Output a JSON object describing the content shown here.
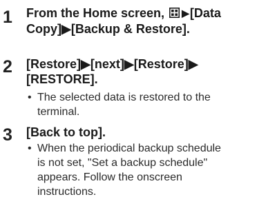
{
  "steps": [
    {
      "number": "1",
      "lines": [
        {
          "a": "From the Home screen, ",
          "icon": "apps-grid-icon",
          "b": "▶",
          "c": "[Data"
        },
        {
          "text": "Copy]▶[Backup & Restore]."
        }
      ]
    },
    {
      "number": "2",
      "line1": "[Restore]▶[next]▶[Restore]▶",
      "line2": "[RESTORE].",
      "note_bullet": "•",
      "note_line1": "The selected data is restored to the",
      "note_line2": "terminal."
    },
    {
      "number": "3",
      "line1": "[Back to top].",
      "note_bullet": "•",
      "note_line1": "When the periodical backup schedule",
      "note_line2": "is not set, \"Set a backup schedule\"",
      "note_line3": "appears. Follow the onscreen",
      "note_line4": "instructions."
    }
  ]
}
